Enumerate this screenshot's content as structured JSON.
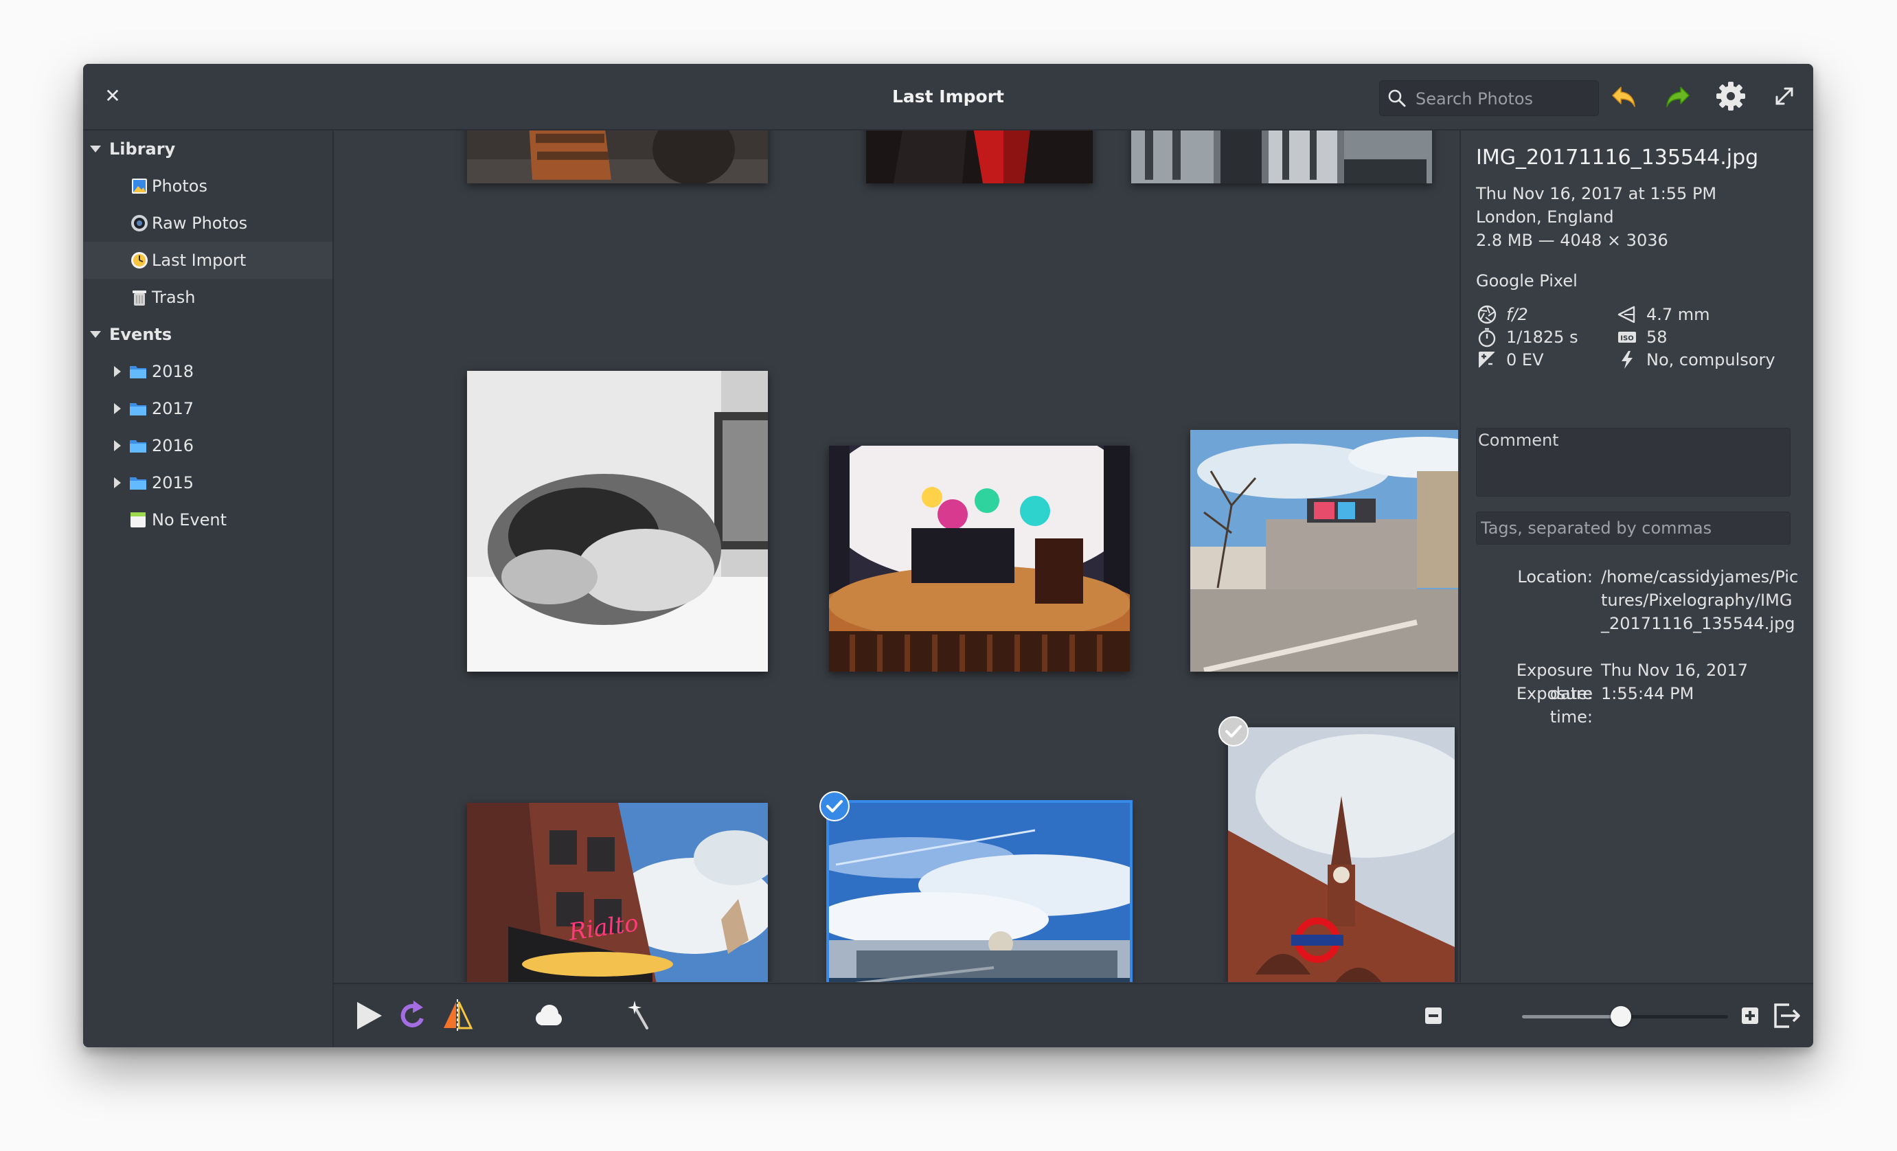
{
  "window": {
    "title": "Last Import"
  },
  "search": {
    "placeholder": "Search Photos"
  },
  "sidebar": {
    "sections": [
      {
        "label": "Library",
        "items": [
          "Photos",
          "Raw Photos",
          "Last Import",
          "Trash"
        ]
      },
      {
        "label": "Events",
        "items": [
          "2018",
          "2017",
          "2016",
          "2015",
          "No Event"
        ]
      }
    ],
    "active_item": "Last Import"
  },
  "info": {
    "filename": "IMG_20171116_135544.jpg",
    "datetime": "Thu Nov 16, 2017 at 1:55 PM",
    "place": "London, England",
    "size_dims": "2.8 MB — 4048 × 3036",
    "camera": "Google Pixel",
    "aperture": "f/2",
    "focal_length": "4.7 mm",
    "shutter": "1/1825 s",
    "iso": "58",
    "exposure_bias": "0 EV",
    "flash": "No, compulsory",
    "comment_placeholder": "Comment",
    "tags_placeholder": "Tags, separated by commas",
    "location_label": "Location:",
    "location_value": "/home/cassidyjames/Pictures/Pixelography/IMG_20171116_135544.jpg",
    "exposure_date_label": "Exposure date:",
    "exposure_date_value": "Thu Nov 16, 2017",
    "exposure_time_label": "Exposure time:",
    "exposure_time_value": "1:55:44 PM"
  },
  "zoom": {
    "level": 0.48
  },
  "colors": {
    "accent": "#3689e6",
    "undo": "#f9c440",
    "redo": "#68b723",
    "slideshow": "#a56de2"
  },
  "icons": {
    "toolbar": [
      "close-icon",
      "search-icon",
      "undo-icon",
      "redo-icon",
      "gear-icon",
      "fullscreen-icon"
    ],
    "bottombar": [
      "play-icon",
      "rotate-icon",
      "flip-icon",
      "cloud-icon",
      "enhance-icon",
      "zoom-out-icon",
      "zoom-in-icon",
      "export-icon"
    ]
  }
}
